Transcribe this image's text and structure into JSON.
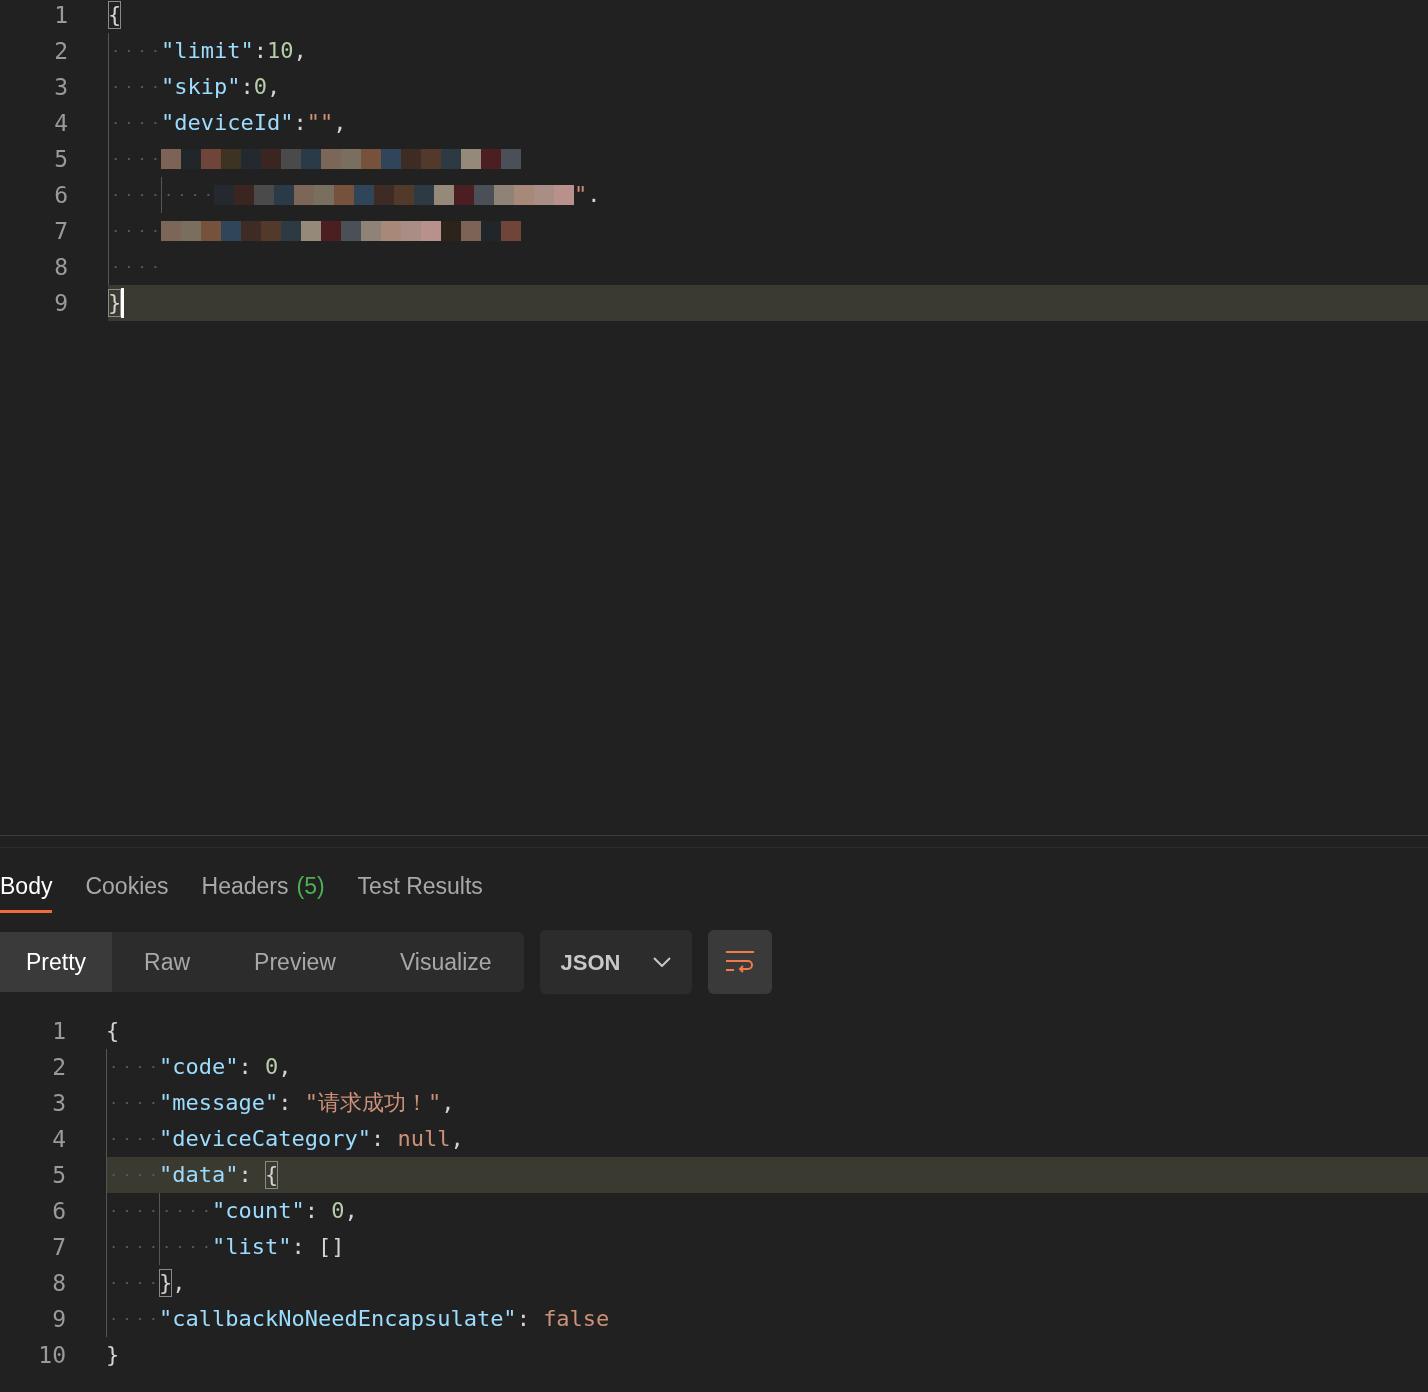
{
  "request_editor": {
    "lines": [
      {
        "number": "1",
        "highlighted": false,
        "cursor": false,
        "tokens": [
          {
            "kind": "bracket-match",
            "text": "{"
          }
        ],
        "children": [
          {
            "number": "2",
            "highlighted": false,
            "cursor": false,
            "tokens": [
              {
                "kind": "key",
                "text": "\"limit\""
              },
              {
                "kind": "punct",
                "text": ":"
              },
              {
                "kind": "number",
                "text": "10"
              },
              {
                "kind": "punct",
                "text": ","
              }
            ]
          },
          {
            "number": "3",
            "highlighted": false,
            "cursor": false,
            "tokens": [
              {
                "kind": "key",
                "text": "\"skip\""
              },
              {
                "kind": "punct",
                "text": ":"
              },
              {
                "kind": "number",
                "text": "0"
              },
              {
                "kind": "punct",
                "text": ","
              }
            ]
          },
          {
            "number": "4",
            "highlighted": false,
            "cursor": false,
            "tokens": [
              {
                "kind": "key",
                "text": "\"deviceId\""
              },
              {
                "kind": "punct",
                "text": ":"
              },
              {
                "kind": "string",
                "text": "\"\""
              },
              {
                "kind": "punct",
                "text": ","
              }
            ]
          },
          {
            "number": "5",
            "highlighted": false,
            "cursor": false,
            "tokens": [
              {
                "kind": "redacted"
              }
            ],
            "children": [
              {
                "number": "6",
                "highlighted": false,
                "cursor": false,
                "tokens": [
                  {
                    "kind": "redacted"
                  },
                  {
                    "kind": "string",
                    "text": "\""
                  },
                  {
                    "kind": "punct",
                    "text": "."
                  }
                ]
              }
            ]
          },
          {
            "number": "7",
            "highlighted": false,
            "cursor": false,
            "tokens": [
              {
                "kind": "redacted"
              }
            ]
          },
          {
            "number": "8",
            "highlighted": false,
            "cursor": false
          }
        ]
      },
      {
        "number": "9",
        "highlighted": true,
        "cursor": true,
        "tokens": [
          {
            "kind": "bracket-match",
            "text": "}"
          }
        ]
      }
    ]
  },
  "response_tabs": [
    {
      "label": "Body",
      "selected": true
    },
    {
      "label": "Cookies",
      "selected": false
    },
    {
      "label": "Headers",
      "count": "(5)",
      "selected": false
    },
    {
      "label": "Test Results",
      "selected": false
    }
  ],
  "view_modes": [
    {
      "label": "Pretty",
      "selected": true
    },
    {
      "label": "Raw",
      "selected": false
    },
    {
      "label": "Preview",
      "selected": false
    },
    {
      "label": "Visualize",
      "selected": false
    }
  ],
  "format_dropdown": {
    "value": "JSON"
  },
  "response_editor": {
    "lines": [
      {
        "number": "1",
        "highlighted": false,
        "cursor": false,
        "tokens": [
          {
            "kind": "punct",
            "text": "{"
          }
        ],
        "children": [
          {
            "number": "2",
            "highlighted": false,
            "cursor": false,
            "tokens": [
              {
                "kind": "key",
                "text": "\"code\""
              },
              {
                "kind": "punct",
                "text": ": "
              },
              {
                "kind": "number",
                "text": "0"
              },
              {
                "kind": "punct",
                "text": ","
              }
            ]
          },
          {
            "number": "3",
            "highlighted": false,
            "cursor": false,
            "tokens": [
              {
                "kind": "key",
                "text": "\"message\""
              },
              {
                "kind": "punct",
                "text": ": "
              },
              {
                "kind": "string",
                "text": "\"请求成功！\""
              },
              {
                "kind": "punct",
                "text": ","
              }
            ]
          },
          {
            "number": "4",
            "highlighted": false,
            "cursor": false,
            "tokens": [
              {
                "kind": "key",
                "text": "\"deviceCategory\""
              },
              {
                "kind": "punct",
                "text": ": "
              },
              {
                "kind": "literal",
                "text": "null"
              },
              {
                "kind": "punct",
                "text": ","
              }
            ]
          },
          {
            "number": "5",
            "highlighted": true,
            "cursor": false,
            "tokens": [
              {
                "kind": "key",
                "text": "\"data\""
              },
              {
                "kind": "punct",
                "text": ": "
              },
              {
                "kind": "bracket-match",
                "text": "{"
              }
            ],
            "children": [
              {
                "number": "6",
                "highlighted": false,
                "cursor": false,
                "tokens": [
                  {
                    "kind": "key",
                    "text": "\"count\""
                  },
                  {
                    "kind": "punct",
                    "text": ": "
                  },
                  {
                    "kind": "number",
                    "text": "0"
                  },
                  {
                    "kind": "punct",
                    "text": ","
                  }
                ]
              },
              {
                "number": "7",
                "highlighted": false,
                "cursor": false,
                "tokens": [
                  {
                    "kind": "key",
                    "text": "\"list\""
                  },
                  {
                    "kind": "punct",
                    "text": ": []"
                  }
                ]
              }
            ]
          },
          {
            "number": "8",
            "highlighted": false,
            "cursor": false,
            "tokens": [
              {
                "kind": "bracket-match",
                "text": "}"
              },
              {
                "kind": "punct",
                "text": ","
              }
            ]
          },
          {
            "number": "9",
            "highlighted": false,
            "cursor": false,
            "tokens": [
              {
                "kind": "key",
                "text": "\"callbackNoNeedEncapsulate\""
              },
              {
                "kind": "punct",
                "text": ": "
              },
              {
                "kind": "literal",
                "text": "false"
              }
            ]
          }
        ]
      },
      {
        "number": "10",
        "highlighted": false,
        "cursor": false,
        "tokens": [
          {
            "kind": "punct",
            "text": "}"
          }
        ]
      }
    ]
  }
}
